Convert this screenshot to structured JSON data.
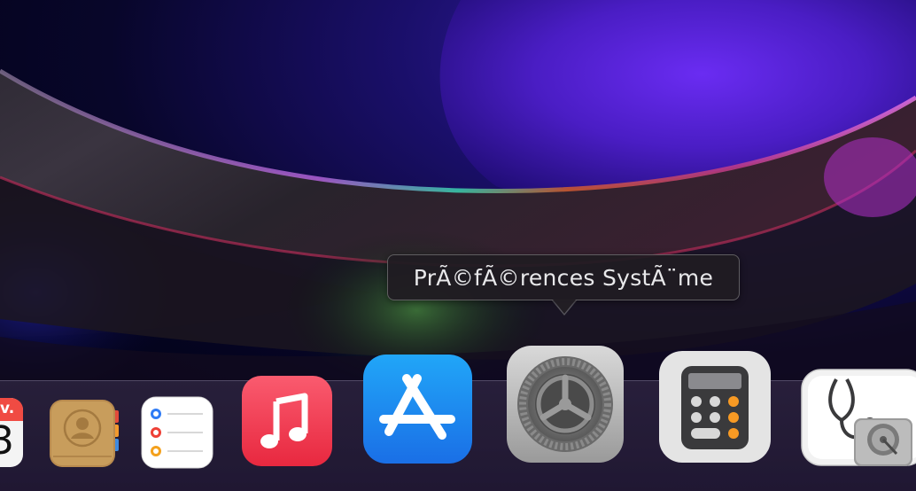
{
  "tooltip": {
    "text": "PrÃ©fÃ©rences SystÃ¨me"
  },
  "calendar": {
    "month": "v.",
    "day": "3"
  },
  "dock_items": [
    {
      "icon": "calendar-icon"
    },
    {
      "icon": "contacts-icon"
    },
    {
      "icon": "reminders-icon"
    },
    {
      "icon": "music-icon"
    },
    {
      "icon": "app-store-icon"
    },
    {
      "icon": "system-preferences-icon"
    },
    {
      "icon": "calculator-icon"
    },
    {
      "icon": "disk-utility-icon"
    }
  ],
  "colors": {
    "music_red": "#f6435b",
    "app_store_blue": "#1d8cf0",
    "reminder_blue": "#2f7bf5",
    "reminder_red": "#ee4036",
    "reminder_orange": "#f4a11d",
    "calculator_orange": "#f79a24"
  }
}
